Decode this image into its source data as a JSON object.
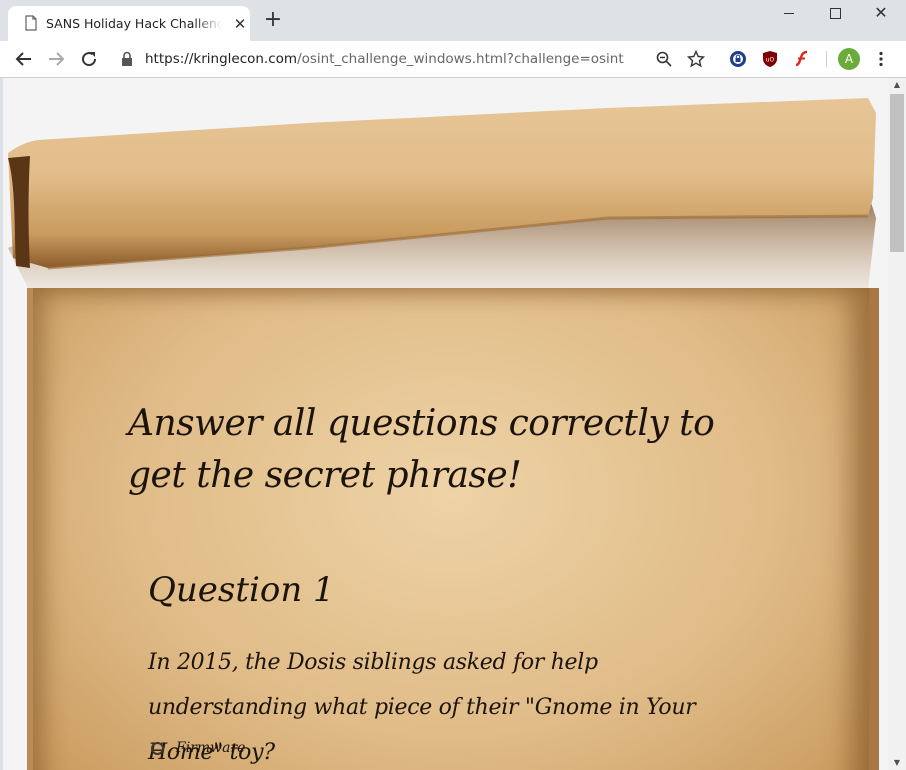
{
  "browser": {
    "tab_title": "SANS Holiday Hack Challenge 20",
    "tab_close": "✕",
    "new_tab": "+",
    "window_close": "✕",
    "url_host": "https://kringlecon.com",
    "url_path": "/osint_challenge_windows.html?challenge=osint",
    "avatar_letter": "A",
    "accent_avatar": "#6aab3a"
  },
  "icons": {
    "back": "arrow-left-icon",
    "forward": "arrow-right-icon",
    "reload": "reload-icon",
    "lock": "lock-icon",
    "zoom": "zoom-out-icon",
    "bookmark": "star-icon",
    "ext1": "password-manager-icon",
    "ext2": "ublock-icon",
    "ext3": "flash-icon",
    "menu": "three-dots-icon"
  },
  "page": {
    "heading": "Answer all questions correctly to get the secret phrase!",
    "question_title": "Question 1",
    "question_text": "In 2015, the Dosis siblings asked for help understanding what piece of their \"Gnome in Your Home\" toy?",
    "options": [
      "Firmware"
    ]
  }
}
